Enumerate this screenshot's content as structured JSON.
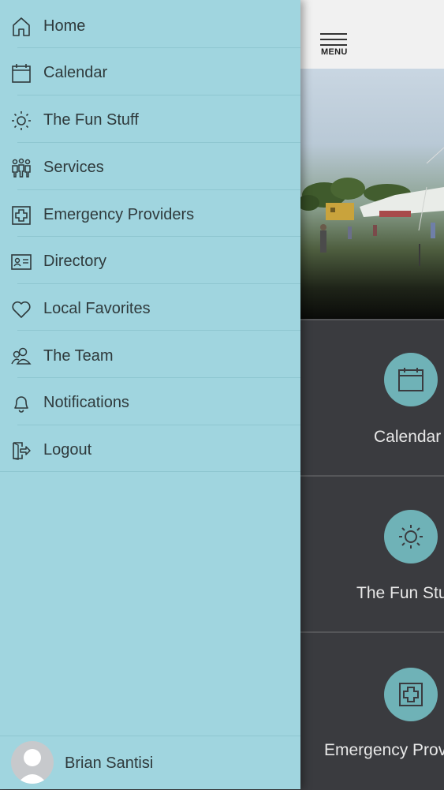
{
  "drawer": {
    "items": [
      {
        "label": "Home",
        "icon": "home-icon"
      },
      {
        "label": "Calendar",
        "icon": "calendar-icon"
      },
      {
        "label": "The Fun Stuff",
        "icon": "sun-icon"
      },
      {
        "label": "Services",
        "icon": "people-group-icon"
      },
      {
        "label": "Emergency Providers",
        "icon": "medical-cross-icon"
      },
      {
        "label": "Directory",
        "icon": "id-card-icon"
      },
      {
        "label": "Local Favorites",
        "icon": "heart-icon"
      },
      {
        "label": "The Team",
        "icon": "team-icon"
      },
      {
        "label": "Notifications",
        "icon": "bell-icon"
      },
      {
        "label": "Logout",
        "icon": "logout-icon"
      }
    ],
    "user": {
      "name": "Brian Santisi"
    }
  },
  "app": {
    "menu_label": "MENU",
    "tiles": [
      {
        "label": "Calendar",
        "icon": "calendar-icon"
      },
      {
        "label": "The Fun Stuff",
        "icon": "sun-icon"
      },
      {
        "label": "Emergency Providers",
        "icon": "medical-cross-icon"
      }
    ]
  },
  "colors": {
    "drawer": "#a0d5df",
    "accent": "#6fb2b7",
    "dark": "#3a3b3f"
  }
}
